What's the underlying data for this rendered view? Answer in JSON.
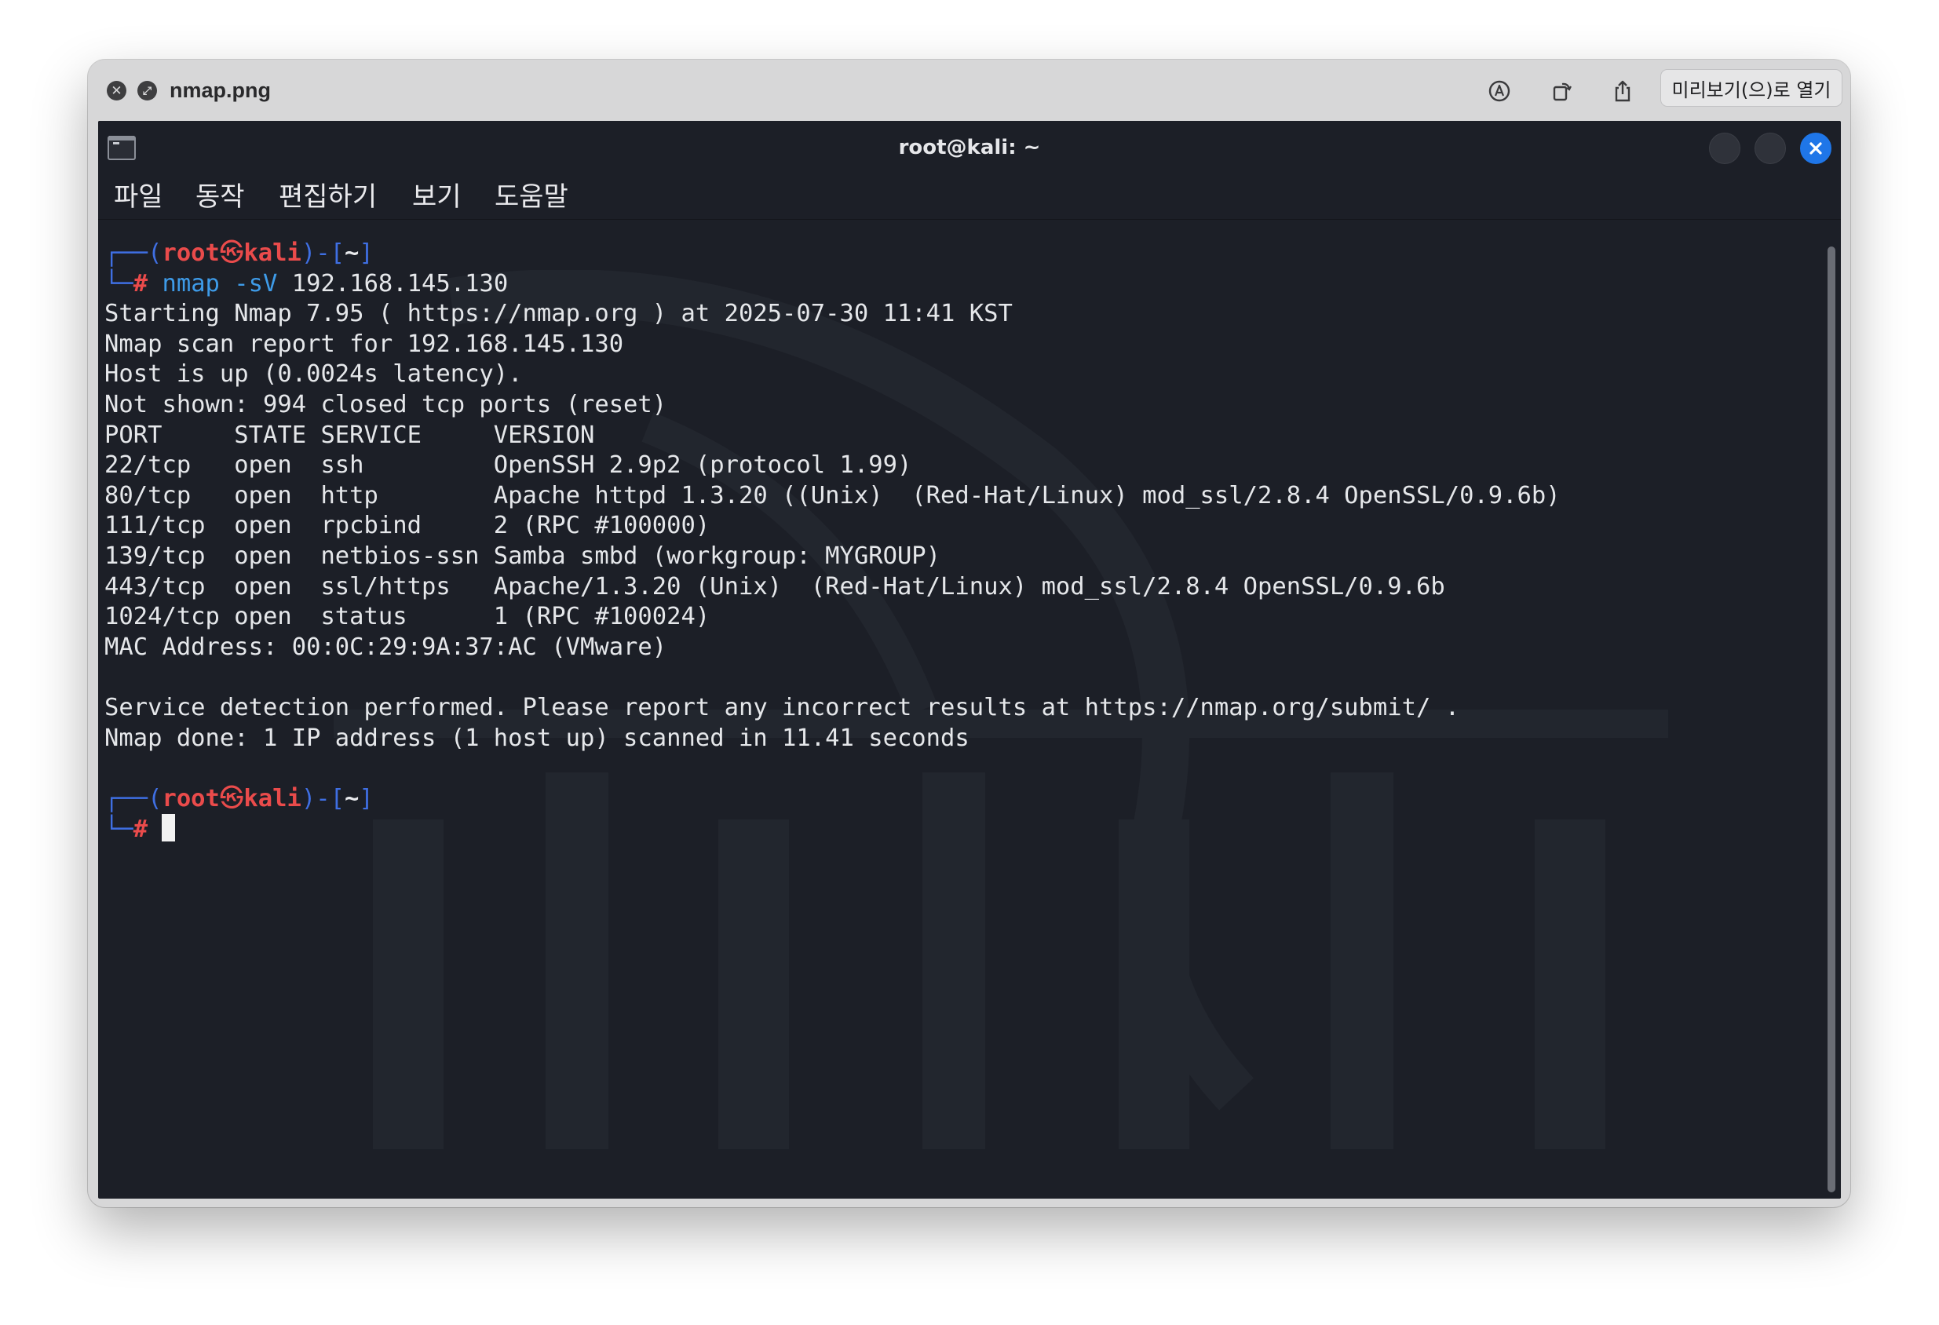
{
  "preview": {
    "filename": "nmap.png",
    "open_with_label": "미리보기(으)로 열기",
    "icons": {
      "close": "close-icon",
      "fullscreen": "fullscreen-icon",
      "markup": "markup-pen-icon",
      "rotate": "rotate-icon",
      "share": "share-icon"
    }
  },
  "terminal": {
    "title": "root@kali: ~",
    "menu": [
      "파일",
      "동작",
      "편집하기",
      "보기",
      "도움말"
    ],
    "colors": {
      "background": "#1c1f27",
      "prompt_frame": "#3f6fe3",
      "prompt_user": "#ea4b4b",
      "command": "#3e9be8",
      "text": "#e5e7ea",
      "close_button": "#1f76e8"
    },
    "lines": [
      [
        {
          "t": "┌──(",
          "c": "frame"
        },
        {
          "t": "root",
          "c": "root"
        },
        {
          "t": "㉿",
          "c": "skull"
        },
        {
          "t": "kali",
          "c": "host"
        },
        {
          "t": ")-[",
          "c": "frame"
        },
        {
          "t": "~",
          "c": "path"
        },
        {
          "t": "]",
          "c": "frame"
        }
      ],
      [
        {
          "t": "└─",
          "c": "frame"
        },
        {
          "t": "#",
          "c": "hash"
        },
        {
          "t": " nmap",
          "c": "cmd"
        },
        {
          "t": " -sV",
          "c": "opt"
        },
        {
          "t": " 192.168.145.130",
          "c": "arg"
        }
      ],
      [
        {
          "t": "Starting Nmap 7.95 ( https://nmap.org ) at 2025-07-30 11:41 KST",
          "c": "out"
        }
      ],
      [
        {
          "t": "Nmap scan report for 192.168.145.130",
          "c": "out"
        }
      ],
      [
        {
          "t": "Host is up (0.0024s latency).",
          "c": "out"
        }
      ],
      [
        {
          "t": "Not shown: 994 closed tcp ports (reset)",
          "c": "out"
        }
      ],
      [
        {
          "t": "PORT     STATE SERVICE     VERSION",
          "c": "out"
        }
      ],
      [
        {
          "t": "22/tcp   open  ssh         OpenSSH 2.9p2 (protocol 1.99)",
          "c": "out"
        }
      ],
      [
        {
          "t": "80/tcp   open  http        Apache httpd 1.3.20 ((Unix)  (Red-Hat/Linux) mod_ssl/2.8.4 OpenSSL/0.9.6b)",
          "c": "out"
        }
      ],
      [
        {
          "t": "111/tcp  open  rpcbind     2 (RPC #100000)",
          "c": "out"
        }
      ],
      [
        {
          "t": "139/tcp  open  netbios-ssn Samba smbd (workgroup: MYGROUP)",
          "c": "out"
        }
      ],
      [
        {
          "t": "443/tcp  open  ssl/https   Apache/1.3.20 (Unix)  (Red-Hat/Linux) mod_ssl/2.8.4 OpenSSL/0.9.6b",
          "c": "out"
        }
      ],
      [
        {
          "t": "1024/tcp open  status      1 (RPC #100024)",
          "c": "out"
        }
      ],
      [
        {
          "t": "MAC Address: 00:0C:29:9A:37:AC (VMware)",
          "c": "out"
        }
      ],
      [
        {
          "t": "",
          "c": "out"
        }
      ],
      [
        {
          "t": "Service detection performed. Please report any incorrect results at https://nmap.org/submit/ .",
          "c": "out"
        }
      ],
      [
        {
          "t": "Nmap done: 1 IP address (1 host up) scanned in 11.41 seconds",
          "c": "out"
        }
      ],
      [
        {
          "t": "",
          "c": "out"
        }
      ],
      [
        {
          "t": "┌──(",
          "c": "frame"
        },
        {
          "t": "root",
          "c": "root"
        },
        {
          "t": "㉿",
          "c": "skull"
        },
        {
          "t": "kali",
          "c": "host"
        },
        {
          "t": ")-[",
          "c": "frame"
        },
        {
          "t": "~",
          "c": "path"
        },
        {
          "t": "]",
          "c": "frame"
        }
      ],
      [
        {
          "t": "└─",
          "c": "frame"
        },
        {
          "t": "#",
          "c": "hash"
        },
        {
          "t": " ",
          "c": "out"
        },
        {
          "t": "",
          "c": "cursor"
        }
      ]
    ]
  }
}
